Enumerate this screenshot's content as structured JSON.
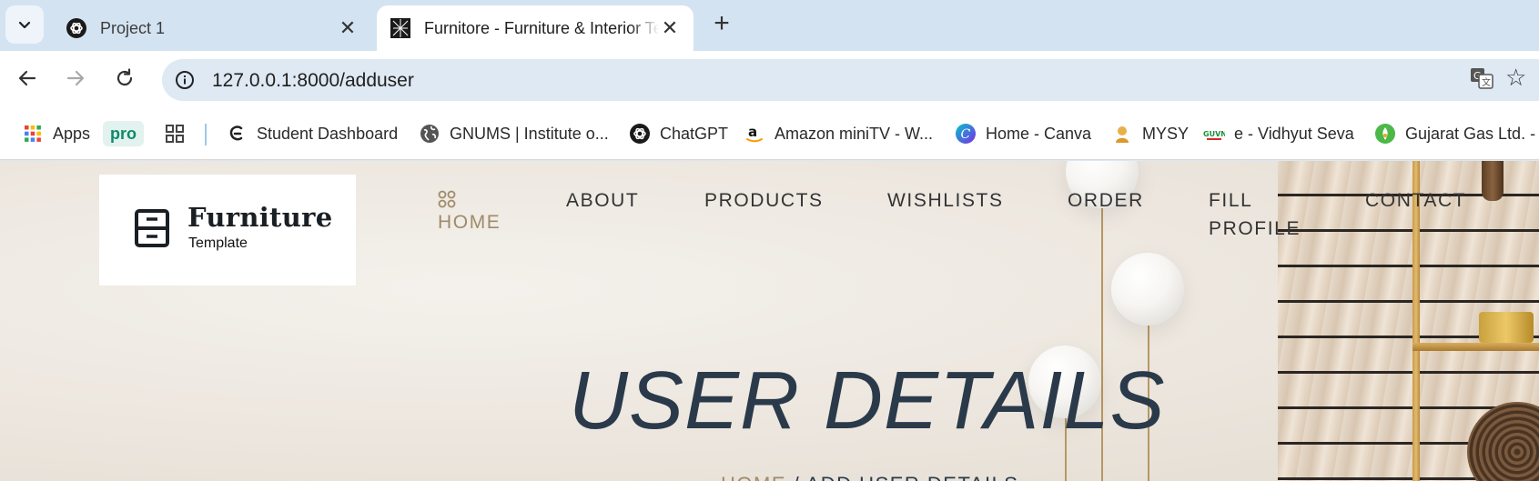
{
  "browser": {
    "tabs": [
      {
        "title": "Project 1",
        "favicon": "openai-icon",
        "active": false
      },
      {
        "title": "Furnitore - Furniture & Interior Template",
        "favicon": "site-logo-icon",
        "active": true
      }
    ],
    "new_tab_label": "+",
    "close_glyph": "✕",
    "url": "127.0.0.1:8000/adduser",
    "bookmarks": [
      {
        "label": "Apps",
        "icon": "apps-grid-icon"
      },
      {
        "label": "pro",
        "icon": ""
      },
      {
        "label": "",
        "icon": "tab-groups-icon"
      },
      {
        "label": "Student Dashboard",
        "icon": "student-icon"
      },
      {
        "label": "GNUMS | Institute o...",
        "icon": "globe-icon"
      },
      {
        "label": "ChatGPT",
        "icon": "openai-icon"
      },
      {
        "label": "Amazon miniTV - W...",
        "icon": "amazon-icon"
      },
      {
        "label": "Home - Canva",
        "icon": "canva-icon"
      },
      {
        "label": "MYSY",
        "icon": "mysy-icon"
      },
      {
        "label": "e - Vidhyut Seva",
        "icon": "guvnl-icon"
      },
      {
        "label": "Gujarat Gas Ltd. - I",
        "icon": "gujarat-gas-icon"
      }
    ]
  },
  "site": {
    "logo": {
      "title": "Furniture",
      "subtitle": "Template"
    },
    "menu": [
      {
        "label": "HOME",
        "active": true
      },
      {
        "label": "ABOUT",
        "active": false
      },
      {
        "label": "PRODUCTS",
        "active": false
      },
      {
        "label": "WISHLISTS",
        "active": false
      },
      {
        "label": "ORDER",
        "active": false
      },
      {
        "label": "FILL PROFILE",
        "active": false
      },
      {
        "label": "CONTACT",
        "active": false
      }
    ],
    "hero": {
      "title": "USER DETAILS",
      "breadcrumb_home": "HOME",
      "breadcrumb_separator": " / ",
      "breadcrumb_current": "ADD USER DETAILS"
    }
  },
  "colors": {
    "accent": "#a08b68",
    "heading": "#2b3a4a",
    "tabstrip": "#d3e3f1"
  }
}
